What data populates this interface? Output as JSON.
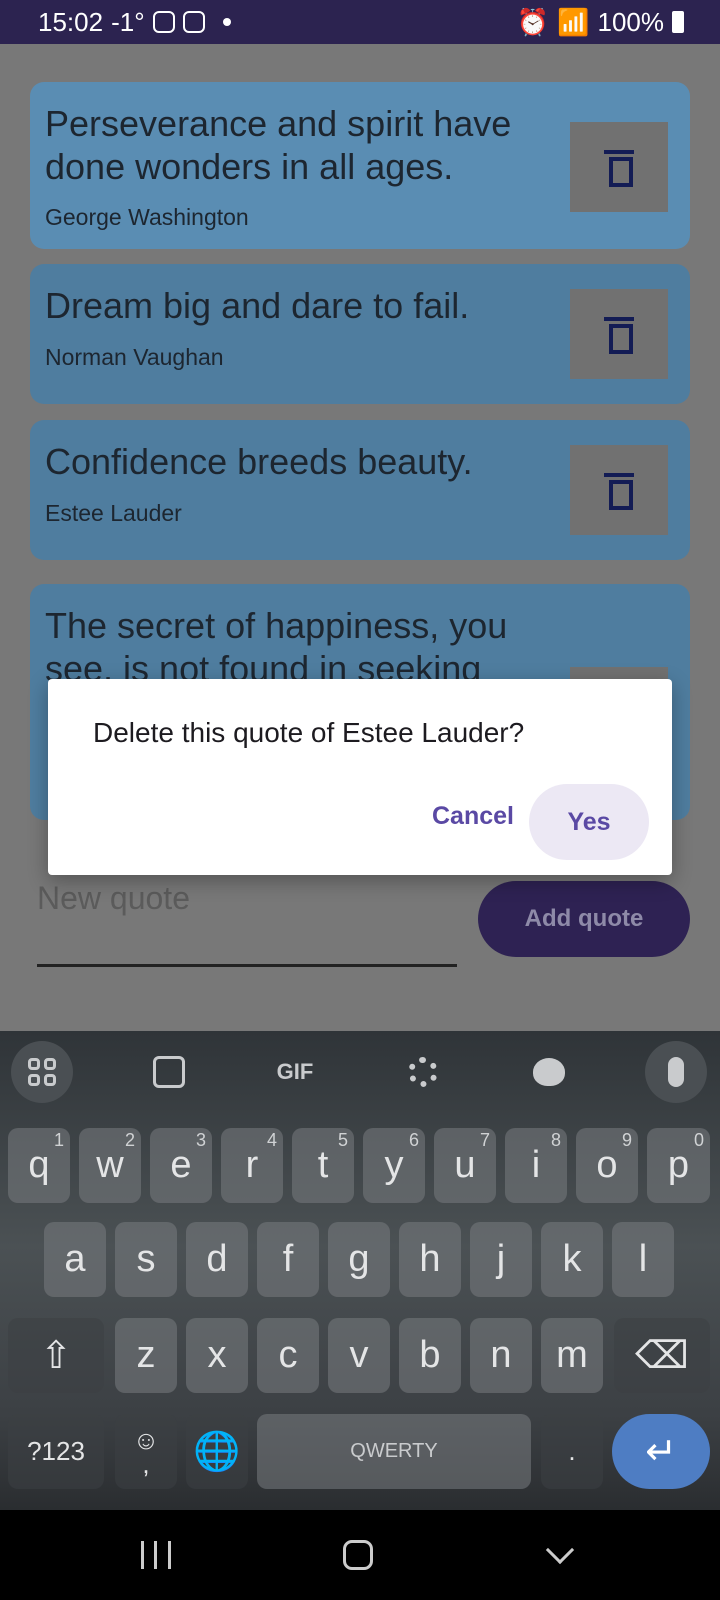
{
  "status_bar": {
    "time": "15:02",
    "temperature": "-1°",
    "battery": "100%"
  },
  "quotes": [
    {
      "text": "Perseverance and spirit have done wonders in all ages.",
      "author": "George Washington"
    },
    {
      "text": "Dream big and dare to fail.",
      "author": "Norman Vaughan"
    },
    {
      "text": "Confidence breeds beauty.",
      "author": "Estee Lauder"
    },
    {
      "text": "The secret of happiness, you see, is not found in seeking",
      "author": ""
    }
  ],
  "input": {
    "placeholder": "New quote",
    "value": ""
  },
  "add_button": {
    "label": "Add quote"
  },
  "dialog": {
    "message": "Delete this quote of Estee Lauder?",
    "cancel_label": "Cancel",
    "yes_label": "Yes"
  },
  "keyboard": {
    "toolbar": {
      "gif_label": "GIF",
      "icons": [
        "grid-icon",
        "sticker-icon",
        "gear-icon",
        "palette-icon",
        "mic-icon"
      ]
    },
    "row1": [
      {
        "key": "q",
        "hint": "1"
      },
      {
        "key": "w",
        "hint": "2"
      },
      {
        "key": "e",
        "hint": "3"
      },
      {
        "key": "r",
        "hint": "4"
      },
      {
        "key": "t",
        "hint": "5"
      },
      {
        "key": "y",
        "hint": "6"
      },
      {
        "key": "u",
        "hint": "7"
      },
      {
        "key": "i",
        "hint": "8"
      },
      {
        "key": "o",
        "hint": "9"
      },
      {
        "key": "p",
        "hint": "0"
      }
    ],
    "row2": [
      "a",
      "s",
      "d",
      "f",
      "g",
      "h",
      "j",
      "k",
      "l"
    ],
    "row3": [
      "z",
      "x",
      "c",
      "v",
      "b",
      "n",
      "m"
    ],
    "symbols_label": "?123",
    "comma_label": ",",
    "emoji_label": "☺",
    "space_label": "QWERTY",
    "period_label": "."
  }
}
